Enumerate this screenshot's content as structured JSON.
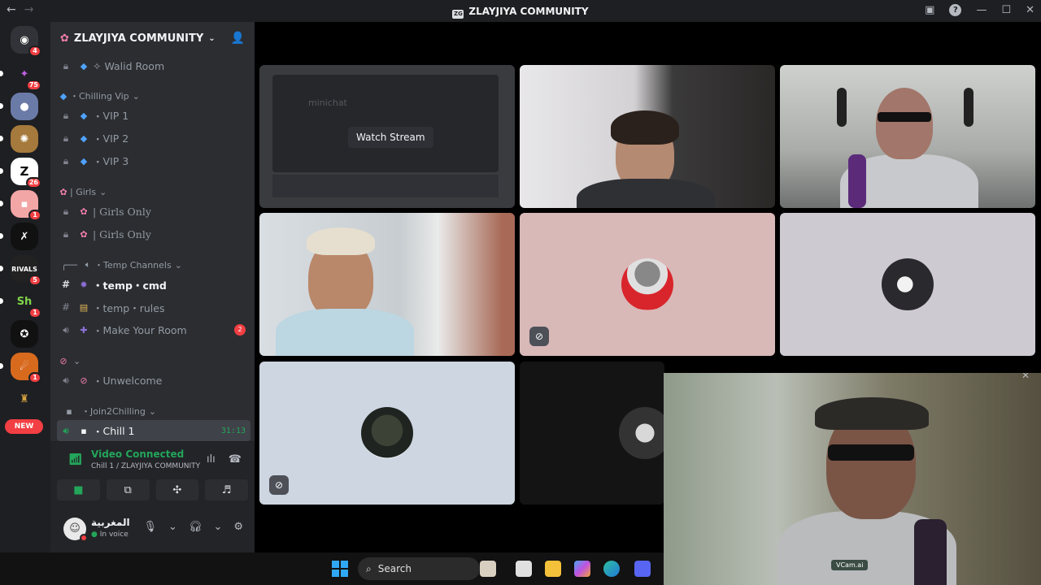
{
  "window": {
    "title": "ZLAYJIYA COMMUNITY"
  },
  "servers": [
    {
      "name": "discord-home",
      "badge": "4"
    },
    {
      "name": "server-2",
      "badge": "75"
    },
    {
      "name": "server-3",
      "badge": ""
    },
    {
      "name": "server-4",
      "badge": ""
    },
    {
      "name": "server-zlayjiya",
      "badge": "26"
    },
    {
      "name": "server-6",
      "badge": "1"
    },
    {
      "name": "server-7",
      "badge": ""
    },
    {
      "name": "server-rivals",
      "badge": "5"
    },
    {
      "name": "server-9",
      "badge": "1"
    },
    {
      "name": "server-10",
      "badge": ""
    },
    {
      "name": "server-11",
      "badge": "1"
    },
    {
      "name": "server-12",
      "badge": ""
    }
  ],
  "new_badge": "NEW",
  "guild": {
    "name": "ZLAYJIYA COMMUNITY"
  },
  "channels": {
    "walid_room": "✧ Walid Room",
    "chilling_vip": "Chilling Vip",
    "vip1": "VIP 1",
    "vip2": "VIP 2",
    "vip3": "VIP 3",
    "girls_cat": "| Girls",
    "girls_only_1": "| Girls Only",
    "girls_only_2": "| Girls Only",
    "temp_channels": "Temp Channels",
    "temp_cmd": "temp・cmd",
    "temp_rules": "temp・rules",
    "make_room": "Make Your Room",
    "make_room_badge": "2",
    "unwelcome": "Unwelcome",
    "join2chilling": "Join2Chilling",
    "chill1": "Chill 1",
    "chill1_timer": "31:13"
  },
  "voice_panel": {
    "status": "Video Connected",
    "location": "Chill 1 / ZLAYJIYA COMMUNITY"
  },
  "user": {
    "name": "المغربية",
    "status": "In voice"
  },
  "stage": {
    "stream_button": "Watch Stream",
    "stream_preview_text": "minichat"
  },
  "vcam": {
    "label": "VCam.ai"
  },
  "taskbar": {
    "search": "Search"
  },
  "colors": {
    "accent_green": "#23a55a",
    "badge_red": "#f23f43",
    "sidebar_bg": "#2b2d31",
    "rail_bg": "#1e1f22"
  }
}
